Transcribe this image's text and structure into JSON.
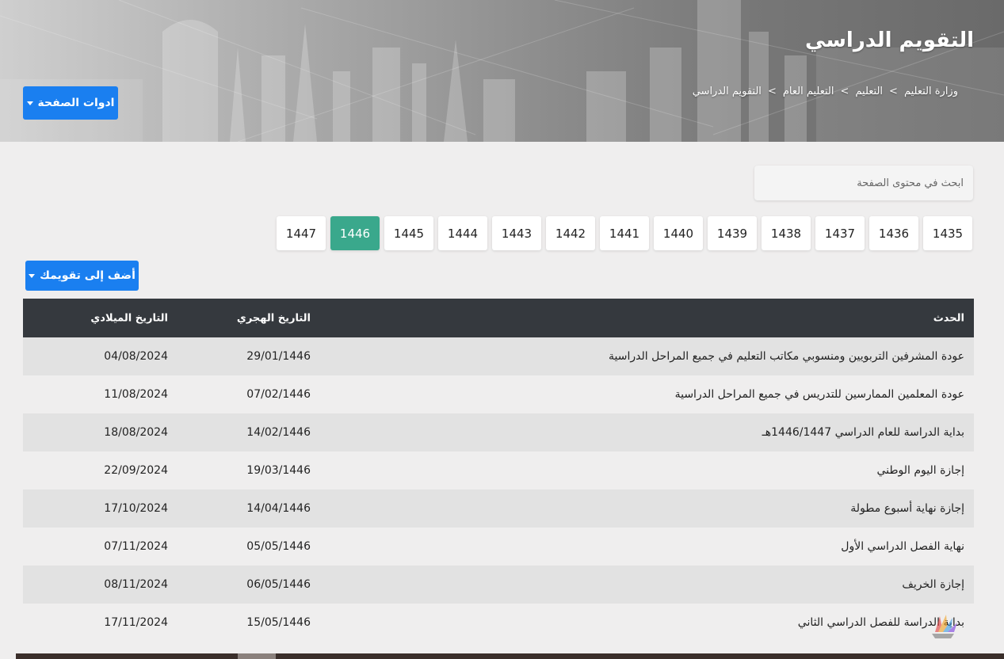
{
  "header": {
    "title": "التقويم الدراسي",
    "breadcrumb": [
      "وزارة التعليم",
      "التعليم",
      "التعليم العام",
      "التقويم الدراسي"
    ],
    "breadcrumb_separator": ">",
    "tools_button": "ادوات الصفحة"
  },
  "search": {
    "placeholder": "ابحث في محتوى الصفحة"
  },
  "years": [
    "1435",
    "1436",
    "1437",
    "1438",
    "1439",
    "1440",
    "1441",
    "1442",
    "1443",
    "1444",
    "1445",
    "1446",
    "1447"
  ],
  "active_year": "1446",
  "add_to_calendar": "أضف إلى تقويمك",
  "table": {
    "headers": {
      "event": "الحدث",
      "hijri": "التاريخ الهجري",
      "gregorian": "التاريخ الميلادي"
    },
    "rows": [
      {
        "event": "عودة المشرفين التربويين ومنسوبي مكاتب التعليم في جميع المراحل الدراسية",
        "hijri": "29/01/1446",
        "gregorian": "04/08/2024"
      },
      {
        "event": "عودة المعلمين الممارسين للتدريس في جميع المراحل الدراسية",
        "hijri": "07/02/1446",
        "gregorian": "11/08/2024"
      },
      {
        "event": "بداية الدراسة للعام الدراسي 1446/1447هـ",
        "hijri": "14/02/1446",
        "gregorian": "18/08/2024"
      },
      {
        "event": "إجازة اليوم الوطني",
        "hijri": "19/03/1446",
        "gregorian": "22/09/2024"
      },
      {
        "event": "إجازة نهاية أسبوع مطولة",
        "hijri": "14/04/1446",
        "gregorian": "17/10/2024"
      },
      {
        "event": "نهاية الفصل الدراسي الأول",
        "hijri": "05/05/1446",
        "gregorian": "07/11/2024"
      },
      {
        "event": "إجازة الخريف",
        "hijri": "06/05/1446",
        "gregorian": "08/11/2024"
      },
      {
        "event": "بداية الدراسة للفصل الدراسي الثاني",
        "hijri": "15/05/1446",
        "gregorian": "17/11/2024"
      }
    ]
  },
  "colors": {
    "primary_button": "#1a7ff0",
    "active_year": "#3aa88c",
    "table_header": "#35393e"
  }
}
